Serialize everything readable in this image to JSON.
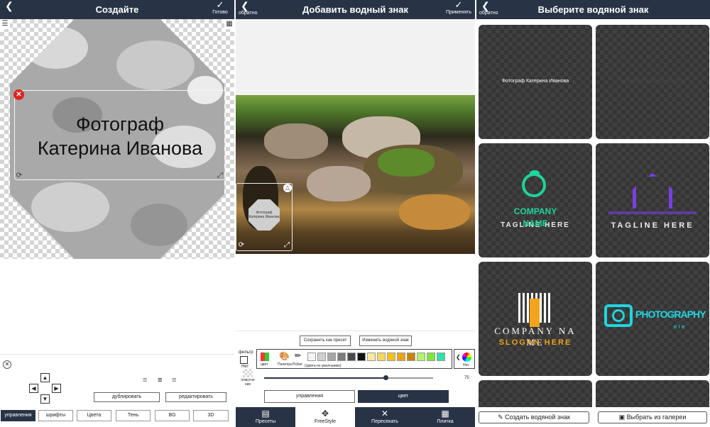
{
  "panel_create": {
    "back_label": "обратно",
    "title": "Создайте",
    "done_label": "Готово",
    "watermark_line1": "Фотограф",
    "watermark_line2": "Катерина Иванова",
    "duplicate_label": "дублировать",
    "edit_label": "редактировать",
    "tabs": [
      "управления",
      "шрифты",
      "Цвета",
      "Тень",
      "BG",
      "3D"
    ]
  },
  "panel_add": {
    "back_label": "обратно",
    "title": "Добавить водный знак",
    "apply_label": "Применять",
    "thumb_text": "Фотограф Катерина Иванова",
    "save_preset_label": "Сохранить как пресет",
    "change_wm_label": "Изменить водяной знак",
    "filter_label": "фильтр",
    "none_label": "Нет",
    "blur_label": "помутне ние",
    "color_label": "цвет",
    "palette_label": "Палитра",
    "picker_label": "Picker",
    "default_colors_label": "(Цвета по умолчанию)",
    "hsv_label": "Hsv",
    "slider_value": "75",
    "slider_level": 0.72,
    "controls_label": "управления",
    "color_tab_label": "цвет",
    "nav": [
      "Пресеты",
      "FreeStyle",
      "Пересекать",
      "Плитка"
    ],
    "swatches": [
      "#f4f4f4",
      "#cfcfcf",
      "#a6a6a6",
      "#7c7c7c",
      "#4a4a4a",
      "#111111",
      "#f9e9a0",
      "#f6d85a",
      "#f2c21b",
      "#e7a70f",
      "#c98506",
      "#b5f36a",
      "#7fe63a",
      "#2fe0a8"
    ]
  },
  "panel_choose": {
    "back_label": "обратно",
    "title": "Выберите водяной знак",
    "cards": [
      {
        "text": "Фотограф Катерина Иванова"
      },
      {
        "text": "Фотограф Катерина Иванова"
      },
      {
        "line1": "COMPANY",
        "line2": "NAME",
        "tagline": "TAGLINE HERE"
      },
      {
        "tagline": "TAGLINE HERE"
      },
      {
        "line1": "COMPANY NA",
        "line2": "ME",
        "tagline": "SLOGAN HERE"
      },
      {
        "line1": "PHOTOGRAPHY",
        "tagline": "ere"
      }
    ],
    "create_label": "Создать водяной знак",
    "gallery_label": "Выбрать из галереи"
  },
  "colors": {
    "bar": "#283346",
    "green": "#1ed49a",
    "purple": "#7a3fe0",
    "orange": "#f2a51b",
    "cyan": "#21d5df",
    "red": "#e0231f"
  }
}
